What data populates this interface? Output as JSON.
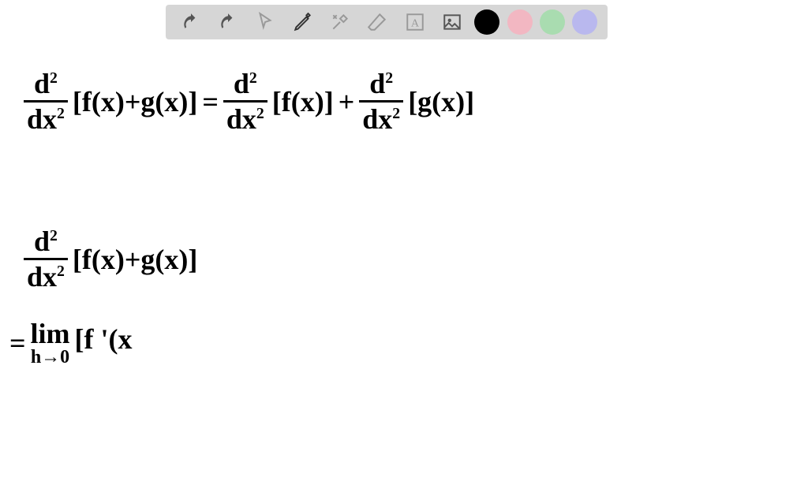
{
  "toolbar": {
    "tools": [
      {
        "name": "undo-icon",
        "label": "Undo"
      },
      {
        "name": "redo-icon",
        "label": "Redo"
      },
      {
        "name": "pointer-icon",
        "label": "Pointer"
      },
      {
        "name": "pen-icon",
        "label": "Pen"
      },
      {
        "name": "tools-icon",
        "label": "Tools"
      },
      {
        "name": "eraser-icon",
        "label": "Eraser"
      },
      {
        "name": "text-icon",
        "label": "Text"
      },
      {
        "name": "image-icon",
        "label": "Image"
      }
    ],
    "colors": [
      {
        "name": "color-black",
        "hex": "#000000"
      },
      {
        "name": "color-pink",
        "hex": "#f2b7c2"
      },
      {
        "name": "color-green",
        "hex": "#a9dcb0"
      },
      {
        "name": "color-purple",
        "hex": "#b9b8ee"
      }
    ]
  },
  "equations": {
    "line1": {
      "lhs_num": "d",
      "lhs_num_sup": "2",
      "lhs_den": "dx",
      "lhs_den_sup": "2",
      "lhs_bracket": "[f(x)+g(x)]",
      "eq": "=",
      "r1_num": "d",
      "r1_num_sup": "2",
      "r1_den": "dx",
      "r1_den_sup": "2",
      "r1_bracket": "[f(x)]",
      "plus": "+",
      "r2_num": "d",
      "r2_num_sup": "2",
      "r2_den": "dx",
      "r2_den_sup": "2",
      "r2_bracket": "[g(x)]"
    },
    "line2": {
      "lhs_num": "d",
      "lhs_num_sup": "2",
      "lhs_den": "dx",
      "lhs_den_sup": "2",
      "lhs_bracket": "[f(x)+g(x)]"
    },
    "line3": {
      "eq": "=",
      "lim": "lim",
      "lim_sub": "h→0",
      "expr": "[f '(x"
    }
  }
}
